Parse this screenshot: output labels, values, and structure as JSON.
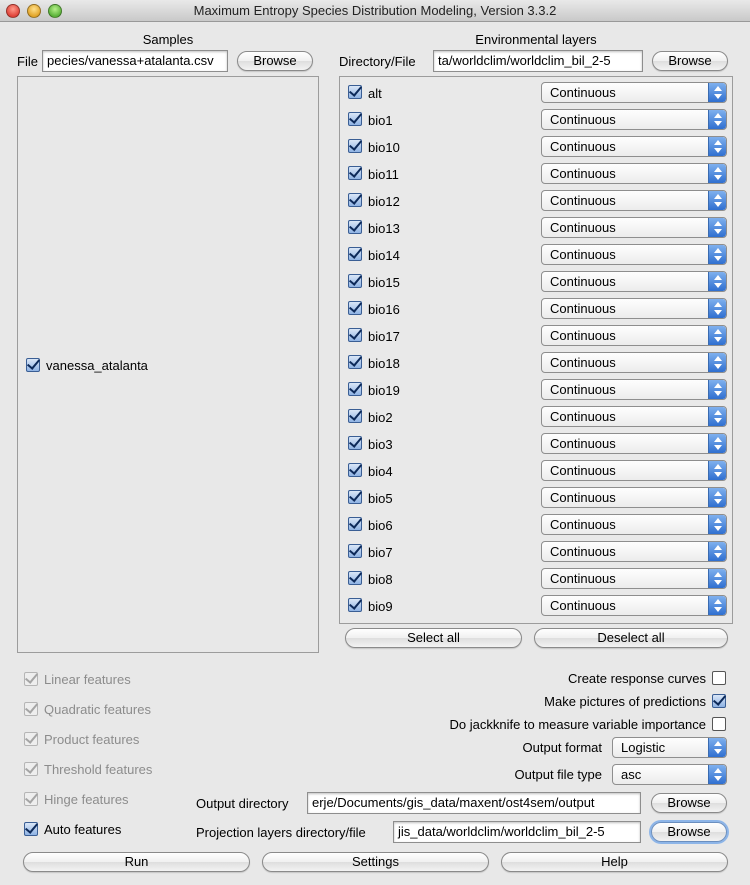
{
  "window": {
    "title": "Maximum Entropy Species Distribution Modeling, Version 3.3.2"
  },
  "samples": {
    "section_title": "Samples",
    "file_label": "File",
    "file_value": "pecies/vanessa+atalanta.csv",
    "browse_label": "Browse",
    "species": [
      {
        "name": "vanessa_atalanta",
        "checked": true
      }
    ]
  },
  "environment": {
    "section_title": "Environmental layers",
    "dir_label": "Directory/File",
    "dir_value": "ta/worldclim/worldclim_bil_2-5",
    "browse_label": "Browse",
    "layers": [
      {
        "name": "alt",
        "type": "Continuous"
      },
      {
        "name": "bio1",
        "type": "Continuous"
      },
      {
        "name": "bio10",
        "type": "Continuous"
      },
      {
        "name": "bio11",
        "type": "Continuous"
      },
      {
        "name": "bio12",
        "type": "Continuous"
      },
      {
        "name": "bio13",
        "type": "Continuous"
      },
      {
        "name": "bio14",
        "type": "Continuous"
      },
      {
        "name": "bio15",
        "type": "Continuous"
      },
      {
        "name": "bio16",
        "type": "Continuous"
      },
      {
        "name": "bio17",
        "type": "Continuous"
      },
      {
        "name": "bio18",
        "type": "Continuous"
      },
      {
        "name": "bio19",
        "type": "Continuous"
      },
      {
        "name": "bio2",
        "type": "Continuous"
      },
      {
        "name": "bio3",
        "type": "Continuous"
      },
      {
        "name": "bio4",
        "type": "Continuous"
      },
      {
        "name": "bio5",
        "type": "Continuous"
      },
      {
        "name": "bio6",
        "type": "Continuous"
      },
      {
        "name": "bio7",
        "type": "Continuous"
      },
      {
        "name": "bio8",
        "type": "Continuous"
      },
      {
        "name": "bio9",
        "type": "Continuous"
      }
    ],
    "select_all_label": "Select all",
    "deselect_all_label": "Deselect all"
  },
  "features": [
    {
      "label": "Linear features",
      "checked": true,
      "enabled": false
    },
    {
      "label": "Quadratic features",
      "checked": true,
      "enabled": false
    },
    {
      "label": "Product features",
      "checked": true,
      "enabled": false
    },
    {
      "label": "Threshold features",
      "checked": true,
      "enabled": false
    },
    {
      "label": "Hinge features",
      "checked": true,
      "enabled": false
    },
    {
      "label": "Auto features",
      "checked": true,
      "enabled": true
    }
  ],
  "options": {
    "response_curves_label": "Create response curves",
    "response_curves_checked": false,
    "pictures_label": "Make pictures of predictions",
    "pictures_checked": true,
    "jackknife_label": "Do jackknife to measure variable importance",
    "jackknife_checked": false,
    "output_format_label": "Output format",
    "output_format_value": "Logistic",
    "output_file_type_label": "Output file type",
    "output_file_type_value": "asc"
  },
  "output": {
    "dir_label": "Output directory",
    "dir_value": "erje/Documents/gis_data/maxent/ost4sem/output",
    "dir_browse_label": "Browse",
    "proj_label": "Projection layers directory/file",
    "proj_value": "jis_data/worldclim/worldclim_bil_2-5",
    "proj_browse_label": "Browse"
  },
  "bottom": {
    "run_label": "Run",
    "settings_label": "Settings",
    "help_label": "Help"
  },
  "colors": {
    "accent": "#2f6fd0",
    "window_bg": "#e8e8e8"
  },
  "icons": {
    "checkbox": "checkmark-icon",
    "select": "up-down-arrows-icon"
  }
}
